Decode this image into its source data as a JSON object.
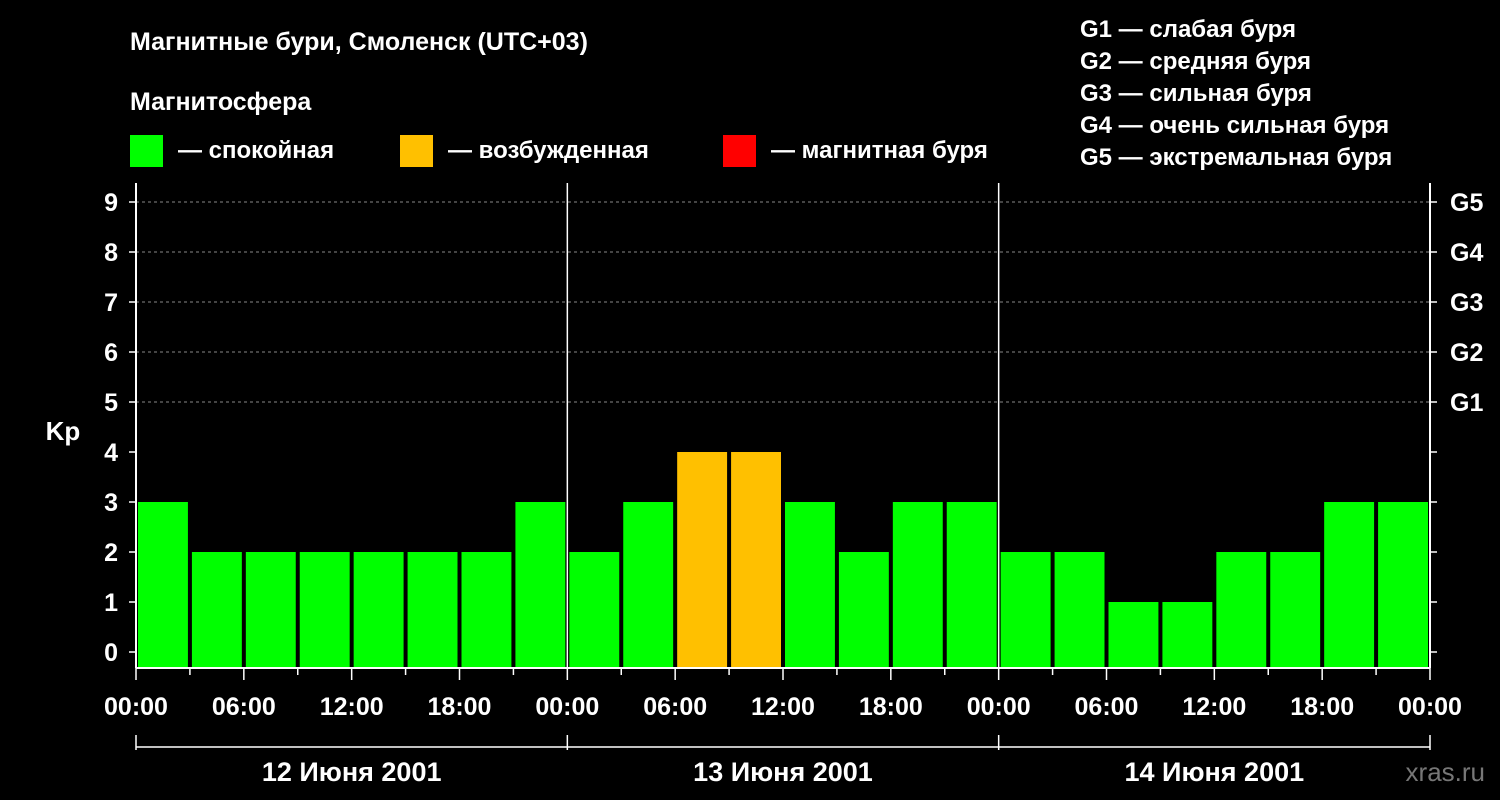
{
  "chart_data": {
    "type": "bar",
    "title": "Магнитные бури, Смоленск (UTC+03)",
    "subtitle": "Магнитосфера",
    "ylabel": "Kp",
    "ylim": [
      0,
      9
    ],
    "yticks": [
      "0",
      "1",
      "2",
      "3",
      "4",
      "5",
      "6",
      "7",
      "8",
      "9"
    ],
    "right_axis_labels": [
      {
        "level": 5,
        "label": "G1"
      },
      {
        "level": 6,
        "label": "G2"
      },
      {
        "level": 7,
        "label": "G3"
      },
      {
        "level": 8,
        "label": "G4"
      },
      {
        "level": 9,
        "label": "G5"
      }
    ],
    "xtick_labels": [
      "00:00",
      "06:00",
      "12:00",
      "18:00",
      "00:00",
      "06:00",
      "12:00",
      "18:00",
      "00:00",
      "06:00",
      "12:00",
      "18:00",
      "00:00"
    ],
    "days": [
      "12 Июня 2001",
      "13 Июня 2001",
      "14 Июня 2001"
    ],
    "categories": [
      "12 Июня 2001 00:00",
      "12 Июня 2001 03:00",
      "12 Июня 2001 06:00",
      "12 Июня 2001 09:00",
      "12 Июня 2001 12:00",
      "12 Июня 2001 15:00",
      "12 Июня 2001 18:00",
      "12 Июня 2001 21:00",
      "13 Июня 2001 00:00",
      "13 Июня 2001 03:00",
      "13 Июня 2001 06:00",
      "13 Июня 2001 09:00",
      "13 Июня 2001 12:00",
      "13 Июня 2001 15:00",
      "13 Июня 2001 18:00",
      "13 Июня 2001 21:00",
      "14 Июня 2001 00:00",
      "14 Июня 2001 03:00",
      "14 Июня 2001 06:00",
      "14 Июня 2001 09:00",
      "14 Июня 2001 12:00",
      "14 Июня 2001 15:00",
      "14 Июня 2001 18:00",
      "14 Июня 2001 21:00"
    ],
    "values": [
      3,
      2,
      2,
      2,
      2,
      2,
      2,
      3,
      2,
      3,
      4,
      4,
      3,
      2,
      3,
      3,
      2,
      2,
      1,
      1,
      2,
      2,
      3,
      3
    ],
    "legend": [
      {
        "label": "— спокойная",
        "color": "#00ff00"
      },
      {
        "label": "— возбужденная",
        "color": "#ffc000"
      },
      {
        "label": "— магнитная буря",
        "color": "#ff0000"
      }
    ],
    "color_rule": {
      "calm_max": 3,
      "disturbed_max": 4
    },
    "storm_scale": [
      "G1 — слабая буря",
      "G2 — средняя буря",
      "G3 — сильная буря",
      "G4 — очень сильная буря",
      "G5 — экстремальная буря"
    ],
    "grid": "dashed horizontal at integer Kp levels 5–9",
    "watermark": "xras.ru"
  }
}
